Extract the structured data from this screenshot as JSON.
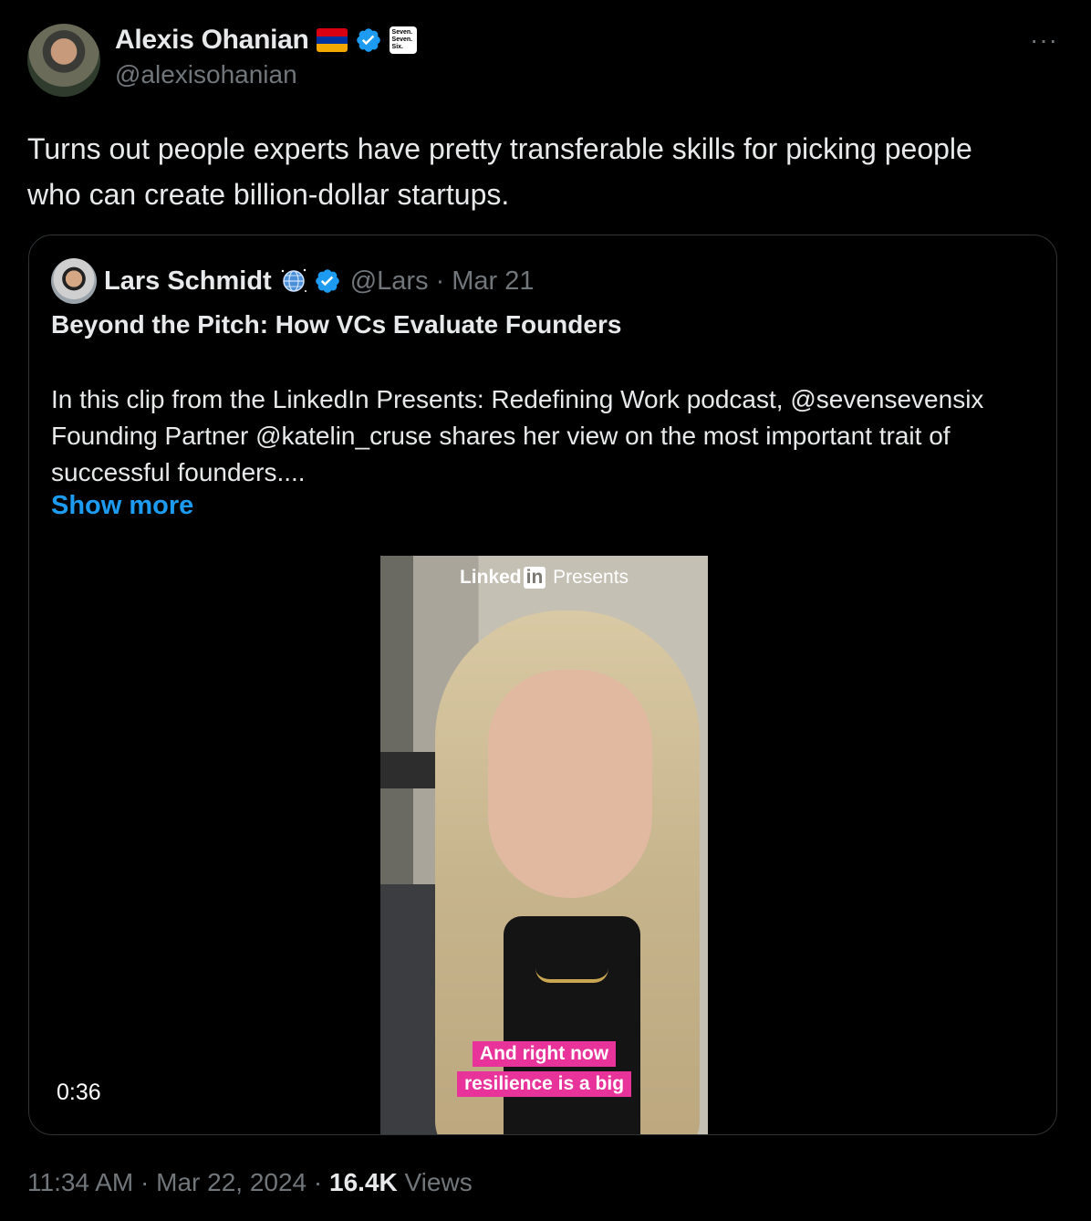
{
  "author": {
    "name": "Alexis Ohanian",
    "handle": "@alexisohanian",
    "org_badge_text": "Seven. Seven. Six."
  },
  "tweet": {
    "text": "Turns out people experts have pretty transferable skills for picking people who can create billion-dollar startups."
  },
  "quote": {
    "name": "Lars Schmidt",
    "handle": "@Lars",
    "separator": "·",
    "date": "Mar 21",
    "title": "Beyond the Pitch: How VCs Evaluate Founders",
    "body": "In this clip from the LinkedIn Presents: Redefining Work podcast, @sevensevensix Founding Partner @katelin_cruse shares her view on the most important trait of successful founders....",
    "show_more": "Show more",
    "video": {
      "brand_left": "Linked",
      "brand_in": "in",
      "brand_right": "Presents",
      "caption_line1": "And right now",
      "caption_line2": "resilience is a big",
      "duration": "0:36"
    }
  },
  "meta": {
    "time": "11:34 AM",
    "sep1": "·",
    "date": "Mar 22, 2024",
    "sep2": "·",
    "views_count": "16.4K",
    "views_label": "Views"
  },
  "more_glyph": "···",
  "colors": {
    "background": "#000000",
    "text": "#e7e9ea",
    "secondary": "#71767b",
    "link": "#1d9bf0",
    "verified": "#1d9bf0",
    "caption_bg": "#e8339a",
    "border": "#2f3336"
  },
  "icons": [
    "armenia-flag-icon",
    "verified-badge-icon",
    "org-affiliation-icon",
    "more-icon",
    "globe-icon"
  ]
}
